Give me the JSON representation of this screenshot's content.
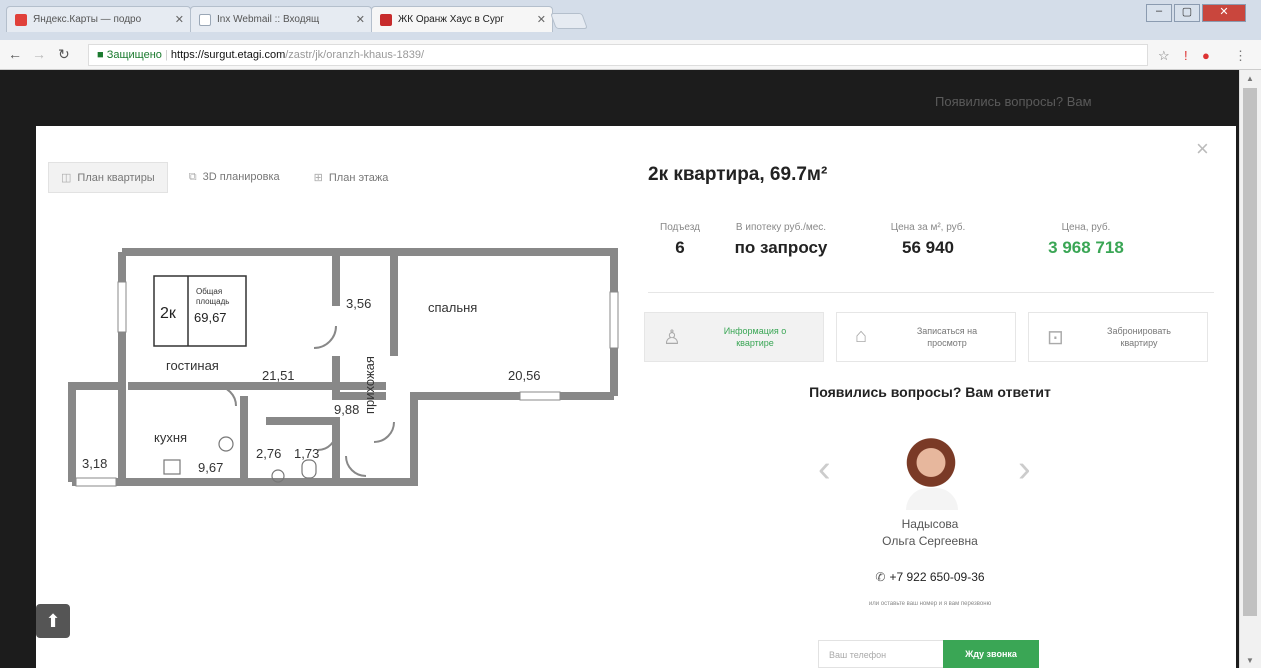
{
  "browser": {
    "tabs": [
      {
        "title": "Яндекс.Карты — подро",
        "active": false,
        "color": "#e0403a"
      },
      {
        "title": "Inx Webmail :: Входящ",
        "active": false,
        "color": "#9aa7b6"
      },
      {
        "title": "ЖК Оранж Хаус в Сург",
        "active": true,
        "color": "#c72b2b"
      }
    ],
    "address": {
      "secure_label": "Защищено",
      "domain": "https://surgut.etagi.com",
      "path": "/zastr/jk/oranzh-khaus-1839/"
    }
  },
  "background": {
    "text": "Появились вопросы? Вам"
  },
  "modal": {
    "plan_tabs": [
      "План квартиры",
      "3D планировка",
      "План этажа"
    ],
    "floorplan": {
      "rooms": {
        "rooms_count": "2к",
        "total_label_1": "Общая",
        "total_label_2": "площадь",
        "total_area": "69,67",
        "living": "гостиная",
        "living_area": "21,51",
        "bedroom": "спальня",
        "bedroom_area": "20,56",
        "closet_area": "3,56",
        "hallway": "прихожая",
        "hallway_area": "9,88",
        "kitchen": "кухня",
        "kitchen_area": "9,67",
        "balcony_area": "3,18",
        "bath_area": "2,76",
        "wc_area": "1,73"
      }
    },
    "title": "2к квартира, 69.7м²",
    "stats": [
      {
        "label": "Подъезд",
        "value": "6"
      },
      {
        "label": "В ипотеку руб./мес.",
        "value": "по запросу"
      },
      {
        "label": "Цена за м², руб.",
        "value": "56 940"
      },
      {
        "label": "Цена, руб.",
        "value": "3 968 718"
      }
    ],
    "actions": [
      {
        "label": "Информация о квартире",
        "icon": "person-icon"
      },
      {
        "label": "Записаться на просмотр",
        "icon": "building-icon"
      },
      {
        "label": "Забронировать квартиру",
        "icon": "lock-icon"
      }
    ],
    "contact": {
      "title": "Появились вопросы? Вам ответит",
      "surname": "Надысова",
      "name": "Ольга Сергеевна",
      "phone": "+7 922 650-09-36",
      "note": "или оставьте ваш номер и я вам перезвоню",
      "input_placeholder": "Ваш телефон",
      "button": "Жду звонка"
    }
  }
}
